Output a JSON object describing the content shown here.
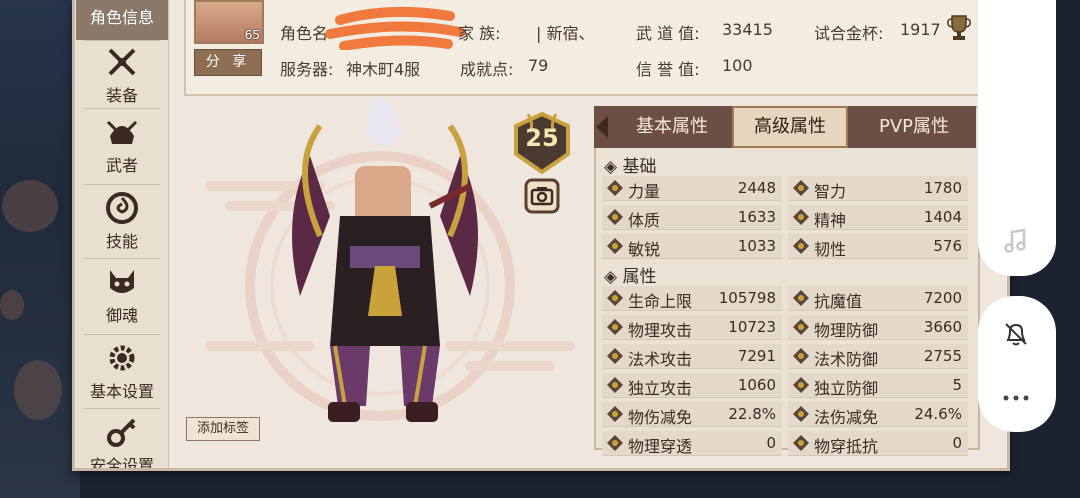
{
  "sidebar": {
    "items": [
      {
        "label": "角色信息",
        "icon": "character-info-icon",
        "active": true
      },
      {
        "label": "装备",
        "icon": "crossed-swords-icon"
      },
      {
        "label": "武者",
        "icon": "samurai-helmet-icon"
      },
      {
        "label": "技能",
        "icon": "swirl-skill-icon"
      },
      {
        "label": "御魂",
        "icon": "fox-mask-icon"
      },
      {
        "label": "基本设置",
        "icon": "gear-icon"
      },
      {
        "label": "安全设置",
        "icon": "key-icon"
      }
    ]
  },
  "header": {
    "avatar_level": "65",
    "share_label": "分 享",
    "role_label": "角色名",
    "clan_label": "家  族:",
    "clan_value": "| 新宿、",
    "server_label": "服务器:",
    "server_value": "神木町4服",
    "achievement_label": "成就点:",
    "achievement_value": "79",
    "wudao_label": "武  道  值:",
    "wudao_value": "33415",
    "honor_label": "信  誉  值:",
    "honor_value": "100",
    "cup_label": "试合金杯:",
    "cup_value": "1917"
  },
  "character": {
    "level": "25",
    "add_tag_label": "添加标签"
  },
  "tabs": [
    {
      "label": "基本属性"
    },
    {
      "label": "高级属性",
      "active": true
    },
    {
      "label": "PVP属性"
    }
  ],
  "sections": {
    "basic": "基础",
    "attributes": "属性"
  },
  "basic_rows": [
    [
      {
        "label": "力量",
        "value": "2448"
      },
      {
        "label": "智力",
        "value": "1780"
      }
    ],
    [
      {
        "label": "体质",
        "value": "1633"
      },
      {
        "label": "精神",
        "value": "1404"
      }
    ],
    [
      {
        "label": "敏锐",
        "value": "1033"
      },
      {
        "label": "韧性",
        "value": "576"
      }
    ]
  ],
  "attr_rows": [
    [
      {
        "label": "生命上限",
        "value": "105798"
      },
      {
        "label": "抗魔值",
        "value": "7200"
      }
    ],
    [
      {
        "label": "物理攻击",
        "value": "10723"
      },
      {
        "label": "物理防御",
        "value": "3660"
      }
    ],
    [
      {
        "label": "法术攻击",
        "value": "7291"
      },
      {
        "label": "法术防御",
        "value": "2755"
      }
    ],
    [
      {
        "label": "独立攻击",
        "value": "1060"
      },
      {
        "label": "独立防御",
        "value": "5"
      }
    ],
    [
      {
        "label": "物伤减免",
        "value": "22.8%"
      },
      {
        "label": "法伤减免",
        "value": "24.6%"
      }
    ],
    [
      {
        "label": "物理穿透",
        "value": "0"
      },
      {
        "label": "物穿抵抗",
        "value": "0"
      }
    ]
  ],
  "colors": {
    "accent": "#6b4f45",
    "panel": "#efe7dd",
    "text": "#3b2c24"
  }
}
